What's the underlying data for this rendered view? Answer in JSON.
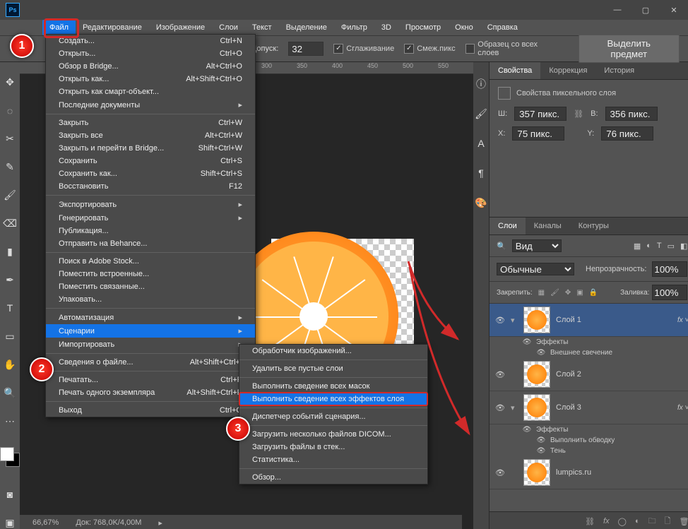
{
  "menubar": [
    "Файл",
    "Редактирование",
    "Изображение",
    "Слои",
    "Текст",
    "Выделение",
    "Фильтр",
    "3D",
    "Просмотр",
    "Окно",
    "Справка"
  ],
  "optbar": {
    "tolerance_label": "Допуск:",
    "tolerance_value": "32",
    "smooth": "Сглаживание",
    "contig": "Смеж.пикс",
    "all_layers": "Образец со всех слоев",
    "select_subject": "Выделить предмет"
  },
  "ruler": [
    "300",
    "350",
    "400",
    "450",
    "500",
    "550"
  ],
  "status": {
    "zoom": "66,67%",
    "doc": "Док: 768,0K/4,00M"
  },
  "file_menu": [
    {
      "l": "Создать...",
      "s": "Ctrl+N"
    },
    {
      "l": "Открыть...",
      "s": "Ctrl+O"
    },
    {
      "l": "Обзор в Bridge...",
      "s": "Alt+Ctrl+O"
    },
    {
      "l": "Открыть как...",
      "s": "Alt+Shift+Ctrl+O"
    },
    {
      "l": "Открыть как смарт-объект..."
    },
    {
      "l": "Последние документы",
      "sub": true
    },
    {
      "sep": true
    },
    {
      "l": "Закрыть",
      "s": "Ctrl+W"
    },
    {
      "l": "Закрыть все",
      "s": "Alt+Ctrl+W"
    },
    {
      "l": "Закрыть и перейти в Bridge...",
      "s": "Shift+Ctrl+W"
    },
    {
      "l": "Сохранить",
      "s": "Ctrl+S"
    },
    {
      "l": "Сохранить как...",
      "s": "Shift+Ctrl+S"
    },
    {
      "l": "Восстановить",
      "s": "F12"
    },
    {
      "sep": true
    },
    {
      "l": "Экспортировать",
      "sub": true
    },
    {
      "l": "Генерировать",
      "sub": true
    },
    {
      "l": "Публикация..."
    },
    {
      "l": "Отправить на Behance..."
    },
    {
      "sep": true
    },
    {
      "l": "Поиск в Adobe Stock..."
    },
    {
      "l": "Поместить встроенные..."
    },
    {
      "l": "Поместить связанные..."
    },
    {
      "l": "Упаковать..."
    },
    {
      "sep": true
    },
    {
      "l": "Автоматизация",
      "sub": true
    },
    {
      "l": "Сценарии",
      "sub": true,
      "hl": true
    },
    {
      "l": "Импортировать",
      "sub": true
    },
    {
      "sep": true
    },
    {
      "l": "Сведения о файле...",
      "s": "Alt+Shift+Ctrl+I"
    },
    {
      "sep": true
    },
    {
      "l": "Печатать...",
      "s": "Ctrl+P"
    },
    {
      "l": "Печать одного экземпляра",
      "s": "Alt+Shift+Ctrl+P"
    },
    {
      "sep": true
    },
    {
      "l": "Выход",
      "s": "Ctrl+Q"
    }
  ],
  "submenu": [
    {
      "l": "Обработчик изображений..."
    },
    {
      "sep": true
    },
    {
      "l": "Удалить все пустые слои"
    },
    {
      "sep": true
    },
    {
      "l": "Выполнить сведение всех масок"
    },
    {
      "l": "Выполнить сведение всех эффектов слоя",
      "hl": true
    },
    {
      "sep": true
    },
    {
      "l": "Диспетчер событий сценария..."
    },
    {
      "sep": true
    },
    {
      "l": "Загрузить несколько файлов DICOM..."
    },
    {
      "l": "Загрузить файлы в стек..."
    },
    {
      "l": "Статистика..."
    },
    {
      "sep": true
    },
    {
      "l": "Обзор..."
    }
  ],
  "props": {
    "tab1": "Свойства",
    "tab2": "Коррекция",
    "tab3": "История",
    "pixel_layer": "Свойства пиксельного слоя",
    "w_lbl": "Ш:",
    "w_val": "357 пикс.",
    "h_lbl": "В:",
    "h_val": "356 пикс.",
    "x_lbl": "X:",
    "x_val": "75 пикс.",
    "y_lbl": "Y:",
    "y_val": "76 пикс."
  },
  "layers": {
    "tab1": "Слои",
    "tab2": "Каналы",
    "tab3": "Контуры",
    "kind": "Вид",
    "blend": "Обычные",
    "opacity_lbl": "Непрозрачность:",
    "opacity": "100%",
    "lock_lbl": "Закрепить:",
    "fill_lbl": "Заливка:",
    "fill": "100%",
    "items": [
      {
        "name": "Слой 1",
        "fx": true,
        "sel": true,
        "eff_header": "Эффекты",
        "effs": [
          "Внешнее свечение"
        ]
      },
      {
        "name": "Слой 2"
      },
      {
        "name": "Слой 3",
        "fx": true,
        "eff_header": "Эффекты",
        "effs": [
          "Выполнить обводку",
          "Тень"
        ]
      },
      {
        "name": "lumpics.ru"
      }
    ]
  }
}
